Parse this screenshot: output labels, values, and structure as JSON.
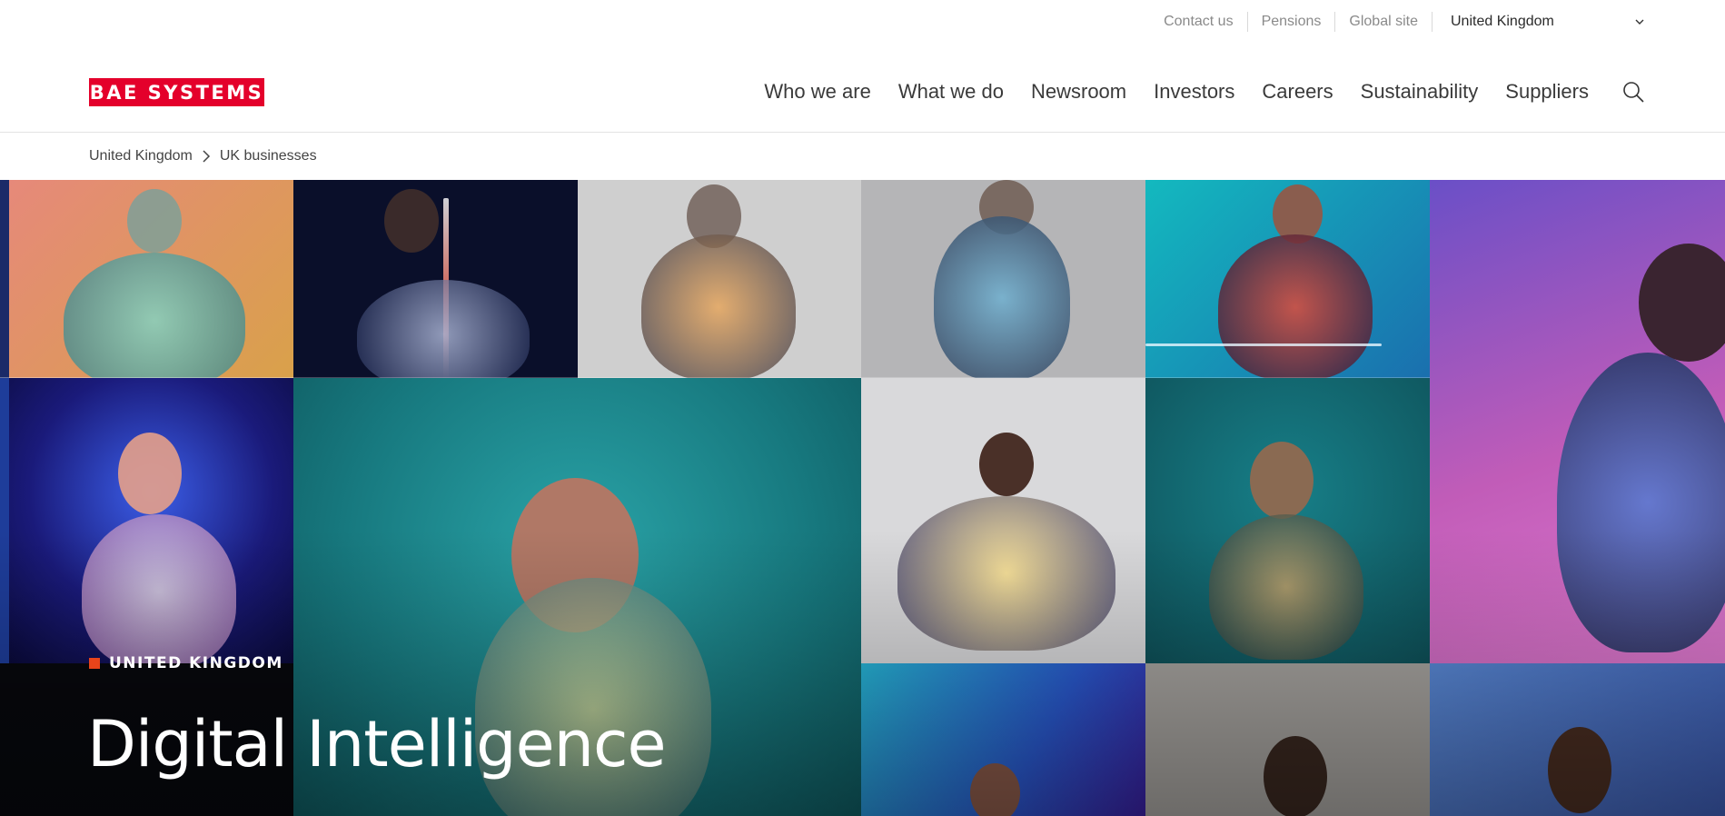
{
  "utility": {
    "links": [
      "Contact us",
      "Pensions",
      "Global site"
    ],
    "country": "United Kingdom"
  },
  "header": {
    "logo_text": "BAE SYSTEMS",
    "nav": [
      "Who we are",
      "What we do",
      "Newsroom",
      "Investors",
      "Careers",
      "Sustainability",
      "Suppliers"
    ]
  },
  "breadcrumb": [
    "United Kingdom",
    "UK businesses"
  ],
  "hero": {
    "eyebrow": "UNITED KINGDOM",
    "title": "Digital Intelligence"
  },
  "colors": {
    "brand_red": "#e4002b",
    "eyebrow_accent": "#e8441a"
  }
}
